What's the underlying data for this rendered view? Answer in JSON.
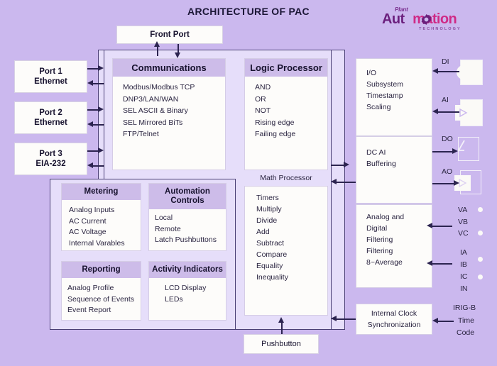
{
  "title": "ARCHITECTURE OF PAC",
  "logo": {
    "plant": "Plant",
    "auto_a": "Aut",
    "auto_b": "mation",
    "tagline": "TECHNOLOGY",
    "gear_icon": "gear-icon",
    "brand_purple": "#6b1f7d",
    "brand_pink": "#cf2a86"
  },
  "front_port": {
    "label": "Front Port"
  },
  "left_ports": [
    {
      "label": "Port 1\nEthernet",
      "line1": "Port 1",
      "line2": "Ethernet"
    },
    {
      "label": "Port 2\nEthernet",
      "line1": "Port 2",
      "line2": "Ethernet"
    },
    {
      "label": "Port 3\nEIA-232",
      "line1": "Port 3",
      "line2": "EIA-232"
    }
  ],
  "communications": {
    "header": "Communications",
    "items": [
      "Modbus/Modbus TCP",
      "DNP3/LAN/WAN",
      "SEL ASCII & Binary",
      "SEL Mirrored BiTs",
      "FTP/Telnet"
    ]
  },
  "logic_processor": {
    "header": "Logic Processor",
    "items": [
      "AND",
      "OR",
      "NOT",
      "Rising edge",
      "Failing edge"
    ]
  },
  "math_processor": {
    "header": "Math Processor",
    "items": [
      "Timers",
      "Multiply",
      "Divide",
      "Add",
      "Subtract",
      "Compare",
      "Equality",
      "Inequality"
    ]
  },
  "metering": {
    "header": "Metering",
    "items": [
      "Analog Inputs",
      "AC Current",
      "AC Voltage",
      "Internal Varables"
    ]
  },
  "automation_controls": {
    "header": "Automation Controls",
    "items": [
      "Local",
      "Remote",
      "Latch Pushbuttons"
    ]
  },
  "reporting": {
    "header": "Reporting",
    "items": [
      "Analog Profile",
      "Sequence of Events",
      "Event Report"
    ]
  },
  "activity_indicators": {
    "header": "Activity Indicators",
    "items": [
      "LCD Display",
      "LEDs"
    ]
  },
  "pushbutton": {
    "label": "Pushbutton"
  },
  "right_modules": [
    {
      "name": "io-subsystem",
      "items": [
        "I/O",
        "Subsystem",
        "Timestamp",
        "Scaling"
      ]
    },
    {
      "name": "dc-ai-buffering",
      "items": [
        "DC AI",
        "Buffering"
      ]
    },
    {
      "name": "analog-digital-filtering",
      "items": [
        "Analog and",
        "Digital",
        "Filtering",
        "Filtering",
        "8~Average"
      ]
    }
  ],
  "internal_clock": {
    "line1": "Internal Clock",
    "line2": "Synchronization"
  },
  "io_points": [
    {
      "label": "DI",
      "icon": "digital-input-icon"
    },
    {
      "label": "AI",
      "icon": "analog-input-icon"
    },
    {
      "label": "DO",
      "icon": "digital-output-icon"
    },
    {
      "label": "AO",
      "icon": "analog-output-icon"
    }
  ],
  "voltage_terminals": [
    "VA",
    "VB",
    "VC"
  ],
  "current_terminals": [
    "IA",
    "IB",
    "IC",
    "IN"
  ],
  "irig": {
    "line1": "IRIG-B",
    "line2": "Time",
    "line3": "Code"
  },
  "colors": {
    "background": "#cbb8ee",
    "panel": "#e6defa",
    "card_header": "#cdbce9",
    "arrow": "#2c2450",
    "box": "#fdfcfa"
  }
}
